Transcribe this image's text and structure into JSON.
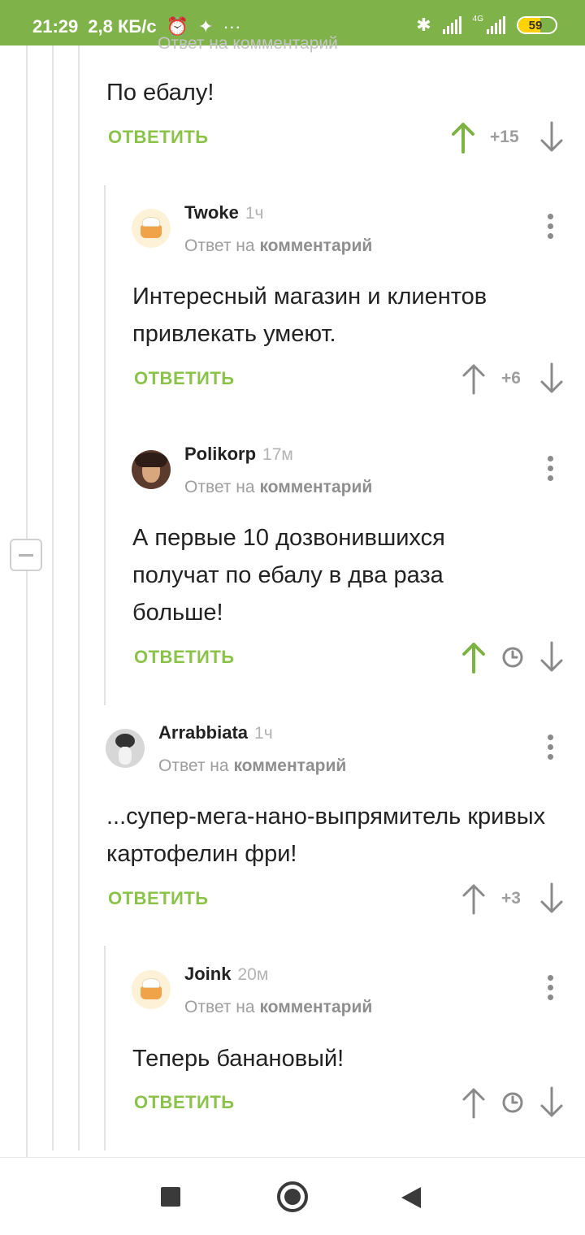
{
  "status_bar": {
    "time": "21:29",
    "speed": "2,8 КБ/с",
    "net_label": "4G",
    "battery_level": "59",
    "battery_fraction": 0.59,
    "bg_color": "#7fb34a"
  },
  "partial_header": "Ответ на комментарий",
  "comments": [
    {
      "text": "По ебалу!",
      "reply_label": "ОТВЕТИТЬ",
      "score": "+15",
      "voted_up": true
    },
    {
      "author": "Twoke",
      "ago": "1ч",
      "reply_to_prefix": "Ответ на",
      "reply_to_link": "комментарий",
      "text": "Интересный магазин и клиентов привлекать умеют.",
      "reply_label": "ОТВЕТИТЬ",
      "score": "+6",
      "voted_up": false
    },
    {
      "author": "Polikorp",
      "ago": "17м",
      "reply_to_prefix": "Ответ на",
      "reply_to_link": "комментарий",
      "text": "А первые 10 дозвонившихся получат по ебалу в два раза больше!",
      "reply_label": "ОТВЕТИТЬ",
      "score": "",
      "voted_up": true,
      "score_pending": true
    },
    {
      "author": "Arrabbiata",
      "ago": "1ч",
      "reply_to_prefix": "Ответ на",
      "reply_to_link": "комментарий",
      "text": "...супер-мега-нано-выпрямитель кривых картофелин фри!",
      "reply_label": "ОТВЕТИТЬ",
      "score": "+3",
      "voted_up": false
    },
    {
      "author": "Joink",
      "ago": "20м",
      "reply_to_prefix": "Ответ на",
      "reply_to_link": "комментарий",
      "text": "Теперь банановый!",
      "reply_label": "ОТВЕТИТЬ",
      "score": "",
      "voted_up": false,
      "score_pending": true
    }
  ],
  "colors": {
    "accent_green": "#8bc34a",
    "vote_up_active": "#7cb342",
    "icon_gray": "#8a8a8a"
  }
}
